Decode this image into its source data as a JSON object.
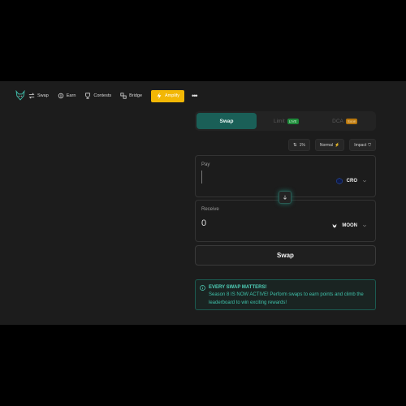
{
  "nav": {
    "items": [
      {
        "label": "Swap",
        "icon": "swap-icon"
      },
      {
        "label": "Earn",
        "icon": "earn-icon"
      },
      {
        "label": "Contests",
        "icon": "contests-icon"
      },
      {
        "label": "Bridge",
        "icon": "bridge-icon"
      }
    ],
    "amplify_label": "Amplify",
    "more_label": "•••"
  },
  "tabs": [
    {
      "label": "Swap",
      "active": true
    },
    {
      "label": "Limit",
      "badge": "LIVE"
    },
    {
      "label": "DCA",
      "badge": "Soon"
    }
  ],
  "settings": {
    "slippage": "1%",
    "speed": "Normal",
    "impact": "Impact"
  },
  "pay": {
    "label": "Pay",
    "amount": "",
    "token": "CRO"
  },
  "receive": {
    "label": "Receive",
    "amount": "0",
    "token": "MOON"
  },
  "swap_button": "Swap",
  "info": {
    "title": "EVERY SWAP MATTERS!",
    "text": "Season 8 IS NOW ACTIVE! Perform swaps to earn points and climb the leaderboard to win exciting rewards!"
  },
  "colors": {
    "accent": "#1a5f57",
    "amplify": "#f2b705",
    "info_text": "#3fc2aa",
    "background": "#1c1c1c"
  }
}
